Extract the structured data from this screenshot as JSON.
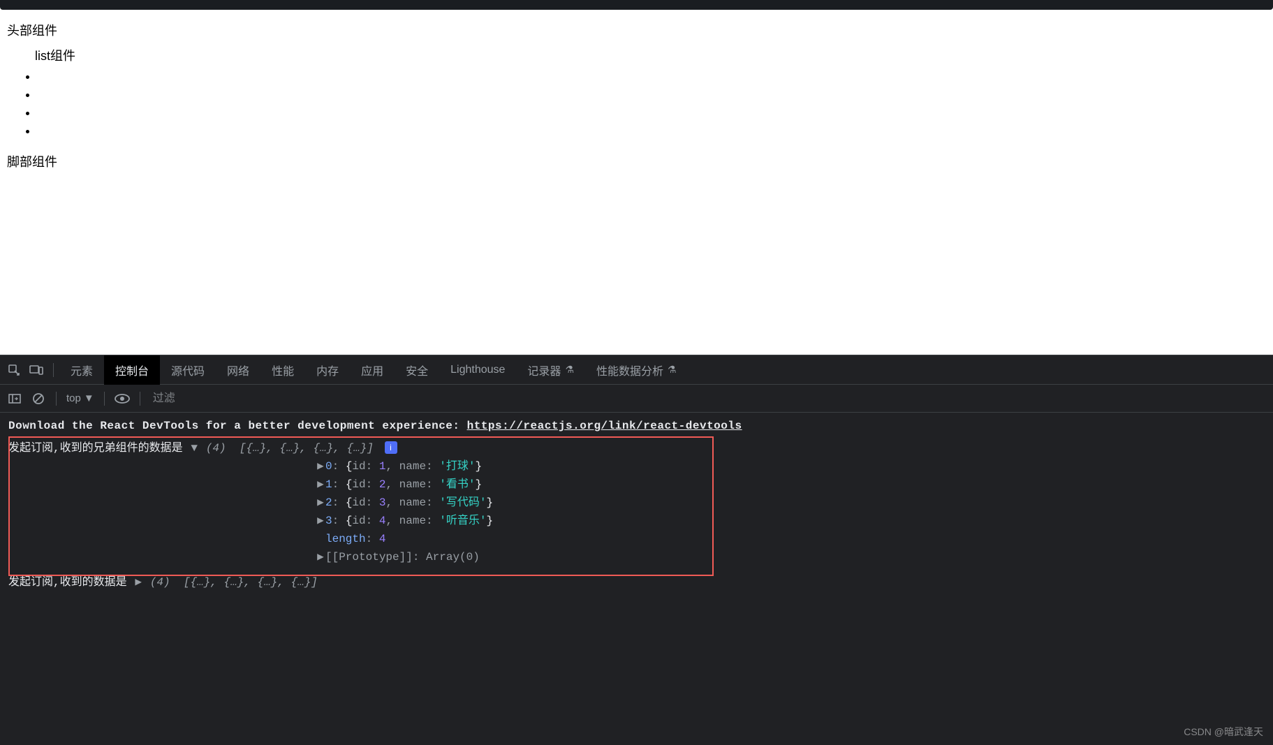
{
  "page": {
    "header": "头部组件",
    "list_label": "list组件",
    "list_items": [
      "",
      "",
      "",
      ""
    ],
    "footer": "脚部组件"
  },
  "devtools": {
    "tabs": [
      "元素",
      "控制台",
      "源代码",
      "网络",
      "性能",
      "内存",
      "应用",
      "安全",
      "Lighthouse",
      "记录器",
      "性能数据分析"
    ],
    "active_tab": "控制台",
    "toolbar": {
      "context": "top",
      "filter_placeholder": "过滤"
    },
    "console": {
      "react_msg_prefix": "Download the React DevTools for a better development experience: ",
      "react_link": "https://reactjs.org/link/react-devtools",
      "log1_prefix": "发起订阅,收到的兄弟组件的数据是",
      "log1_summary_count": "(4)",
      "log1_summary_body": "[{…}, {…}, {…}, {…}]",
      "array_items": [
        {
          "idx": "0",
          "id": "1",
          "name": "打球"
        },
        {
          "idx": "1",
          "id": "2",
          "name": "看书"
        },
        {
          "idx": "2",
          "id": "3",
          "name": "写代码"
        },
        {
          "idx": "3",
          "id": "4",
          "name": "听音乐"
        }
      ],
      "length_label": "length",
      "length_value": "4",
      "proto_label": "[[Prototype]]",
      "proto_value": "Array(0)",
      "log2_prefix": "发起订阅,收到的数据是",
      "log2_summary_count": "(4)",
      "log2_summary_body": "[{…}, {…}, {…}, {…}]"
    },
    "watermark": "CSDN @暗武逢天"
  }
}
